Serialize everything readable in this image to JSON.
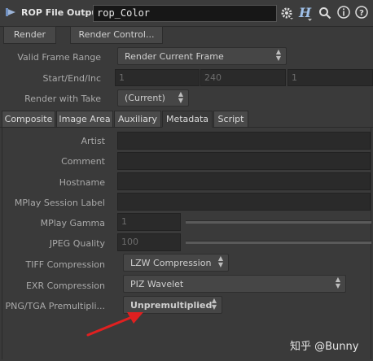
{
  "header": {
    "node_type": "ROP File Output",
    "node_name": "rop_Color",
    "icons": [
      "gear-icon",
      "help-hip-icon",
      "search-icon",
      "info-icon",
      "help-icon"
    ]
  },
  "toolbar": {
    "render_label": "Render",
    "render_control_label": "Render Control..."
  },
  "render": {
    "valid_frame_range_label": "Valid Frame Range",
    "valid_frame_range_value": "Render Current Frame",
    "start_end_inc_label": "Start/End/Inc",
    "start": "1",
    "end": "240",
    "inc": "1",
    "render_with_take_label": "Render with Take",
    "render_with_take_value": "(Current)"
  },
  "tabs": [
    "Composite",
    "Image Area",
    "Auxiliary",
    "Metadata",
    "Script"
  ],
  "active_tab": "Metadata",
  "metadata": {
    "artist_label": "Artist",
    "comment_label": "Comment",
    "hostname_label": "Hostname",
    "mplay_session_label": "MPlay Session Label",
    "mplay_gamma_label": "MPlay Gamma",
    "mplay_gamma_value": "1",
    "jpeg_quality_label": "JPEG Quality",
    "jpeg_quality_value": "100",
    "tiff_compression_label": "TIFF Compression",
    "tiff_compression_value": "LZW Compression",
    "exr_compression_label": "EXR Compression",
    "exr_compression_value": "PIZ Wavelet",
    "png_premultiply_label": "PNG/TGA Premultipli...",
    "png_premultiply_value": "Unpremultiplied"
  },
  "watermark": "知乎 @Bunny",
  "colors": {
    "background": "#3a3a3a",
    "field": "#2a2a2a",
    "annotation_arrow": "#e02020"
  }
}
